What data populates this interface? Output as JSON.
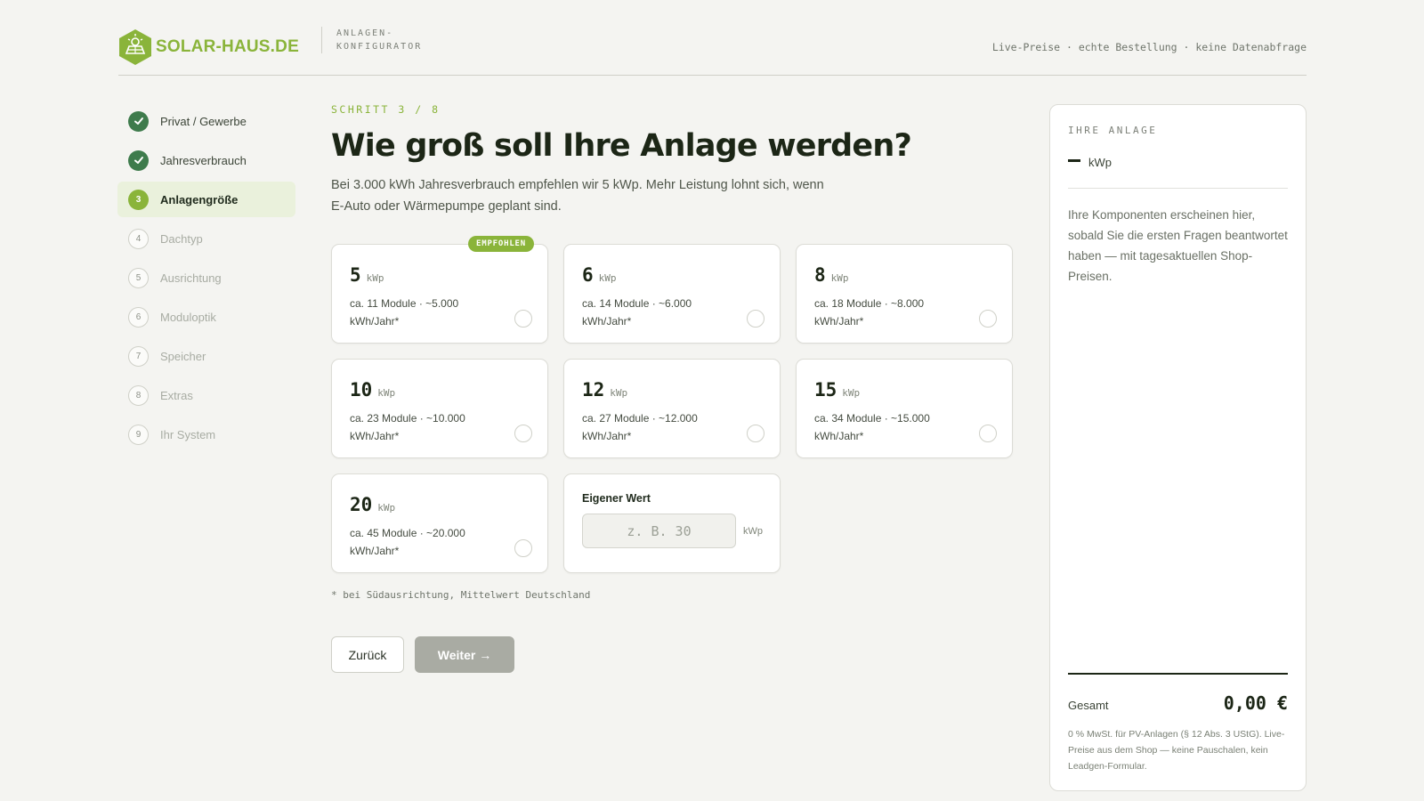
{
  "header": {
    "brand": "SOLAR-HAUS.DE",
    "subtitle": "ANLAGEN-KONFIGURATOR",
    "note": "Live-Preise · echte Bestellung · keine Datenabfrage"
  },
  "steps": [
    {
      "num": "",
      "label": "Privat / Gewerbe",
      "state": "done"
    },
    {
      "num": "",
      "label": "Jahresverbrauch",
      "state": "done"
    },
    {
      "num": "3",
      "label": "Anlagengröße",
      "state": "active"
    },
    {
      "num": "4",
      "label": "Dachtyp",
      "state": "todo"
    },
    {
      "num": "5",
      "label": "Ausrichtung",
      "state": "todo"
    },
    {
      "num": "6",
      "label": "Moduloptik",
      "state": "todo"
    },
    {
      "num": "7",
      "label": "Speicher",
      "state": "todo"
    },
    {
      "num": "8",
      "label": "Extras",
      "state": "todo"
    },
    {
      "num": "9",
      "label": "Ihr System",
      "state": "todo"
    }
  ],
  "main": {
    "eyebrow": "SCHRITT 3 / 8",
    "title": "Wie groß soll Ihre Anlage werden?",
    "lead": "Bei 3.000 kWh Jahresverbrauch empfehlen wir 5 kWp. Mehr Leistung lohnt sich, wenn E-Auto oder Wärmepumpe geplant sind.",
    "options": [
      {
        "size": "5",
        "unit": "kWp",
        "desc": "ca. 11 Module · ~5.000 kWh/Jahr*",
        "badge": "EMPFOHLEN"
      },
      {
        "size": "6",
        "unit": "kWp",
        "desc": "ca. 14 Module · ~6.000 kWh/Jahr*",
        "badge": ""
      },
      {
        "size": "8",
        "unit": "kWp",
        "desc": "ca. 18 Module · ~8.000 kWh/Jahr*",
        "badge": ""
      },
      {
        "size": "10",
        "unit": "kWp",
        "desc": "ca. 23 Module · ~10.000 kWh/Jahr*",
        "badge": ""
      },
      {
        "size": "12",
        "unit": "kWp",
        "desc": "ca. 27 Module · ~12.000 kWh/Jahr*",
        "badge": ""
      },
      {
        "size": "15",
        "unit": "kWp",
        "desc": "ca. 34 Module · ~15.000 kWh/Jahr*",
        "badge": ""
      },
      {
        "size": "20",
        "unit": "kWp",
        "desc": "ca. 45 Module · ~20.000 kWh/Jahr*",
        "badge": ""
      }
    ],
    "custom": {
      "label": "Eigener Wert",
      "placeholder": "z. B. 30",
      "unit": "kWp",
      "value": ""
    },
    "footnote": "* bei Südausrichtung, Mittelwert Deutschland",
    "back_label": "Zurück",
    "next_label": "Weiter →"
  },
  "summary": {
    "eyebrow": "IHRE ANLAGE",
    "power_unit": "kWp",
    "text": "Ihre Komponenten erscheinen hier, sobald Sie die ersten Fragen beantwortet haben — mit tagesaktuellen Shop-Preisen.",
    "total_label": "Gesamt",
    "total_value": "0,00 €",
    "note": "0 % MwSt. für PV-Anlagen (§ 12 Abs. 3 UStG). Live-Preise aus dem Shop — keine Pauschalen, kein Leadgen-Formular."
  },
  "colors": {
    "accent": "#8ab43a",
    "done": "#3e7b4c",
    "disabled": "#a9aba3"
  },
  "icons": {
    "logo": "solar-panel-hex-icon",
    "done": "check-icon"
  }
}
